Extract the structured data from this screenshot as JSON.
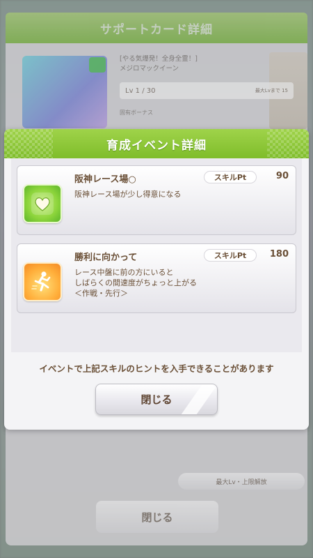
{
  "background": {
    "title": "サポートカード詳細",
    "card_title_line1": "[やる気爆発！全身全霊！]",
    "card_title_line2": "メジロマックイーン",
    "level": "Lv 1 / 30",
    "level_sub": "最大Lvまで 15",
    "note": "固有ボーナス",
    "small_button": "最大Lv・上限解放",
    "close_label": "閉じる"
  },
  "modal": {
    "title": "育成イベント詳細",
    "skills": [
      {
        "name": "阪神レース場○",
        "pt_label": "スキルPt",
        "pt_value": "90",
        "desc": "阪神レース場が少し得意になる",
        "icon": "heart-icon",
        "icon_color": "#8cd43b"
      },
      {
        "name": "勝利に向かって",
        "pt_label": "スキルPt",
        "pt_value": "180",
        "desc": "レース中盤に前の方にいると\nしばらくの間速度がちょっと上がる\n＜作戦・先行＞",
        "icon": "running-icon",
        "icon_color": "#ffae3a"
      }
    ],
    "notice": "イベントで上記スキルのヒントを入手できることがあります",
    "close_label": "閉じる"
  },
  "colors": {
    "header_green": "#8cc63f",
    "text_brown": "#6a4f36"
  }
}
